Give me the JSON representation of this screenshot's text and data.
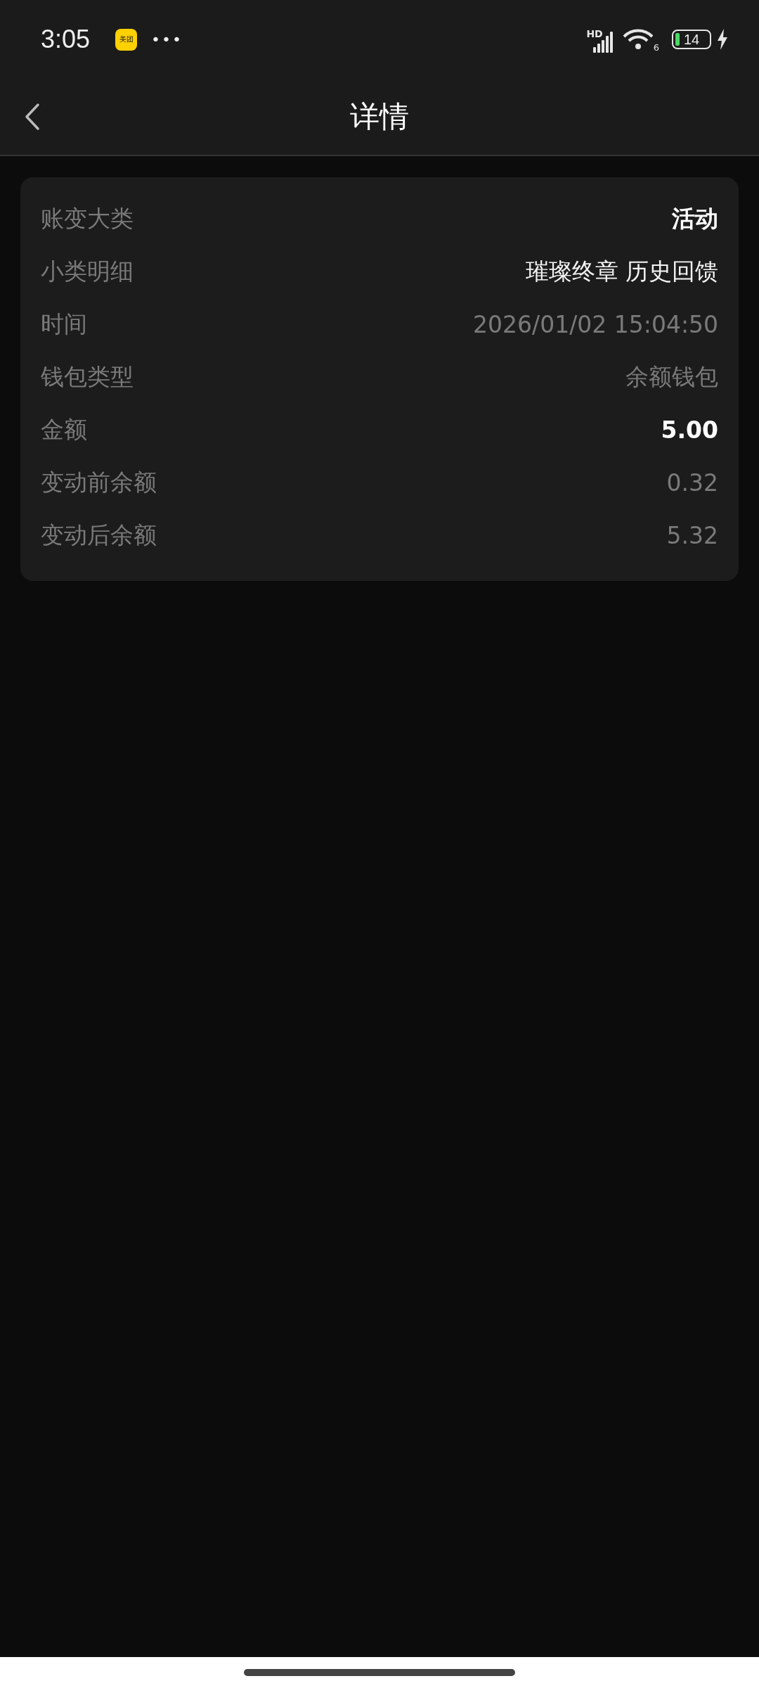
{
  "status_bar": {
    "time": "3:05",
    "app_badge": "美团",
    "more": "•••",
    "network": "HD",
    "wifi_gen": "6",
    "battery": "14"
  },
  "nav": {
    "title": "详情"
  },
  "rows": [
    {
      "label": "账变大类",
      "value": "活动",
      "kind": "emphasis"
    },
    {
      "label": "小类明细",
      "value": "璀璨终章 历史回馈",
      "kind": "normal"
    },
    {
      "label": "时间",
      "value": "2026/01/02 15:04:50",
      "kind": "muted"
    },
    {
      "label": "钱包类型",
      "value": "余额钱包",
      "kind": "muted"
    },
    {
      "label": "金额",
      "value": "5.00",
      "kind": "emphasis"
    },
    {
      "label": "变动前余额",
      "value": "0.32",
      "kind": "muted"
    },
    {
      "label": "变动后余额",
      "value": "5.32",
      "kind": "muted"
    }
  ]
}
